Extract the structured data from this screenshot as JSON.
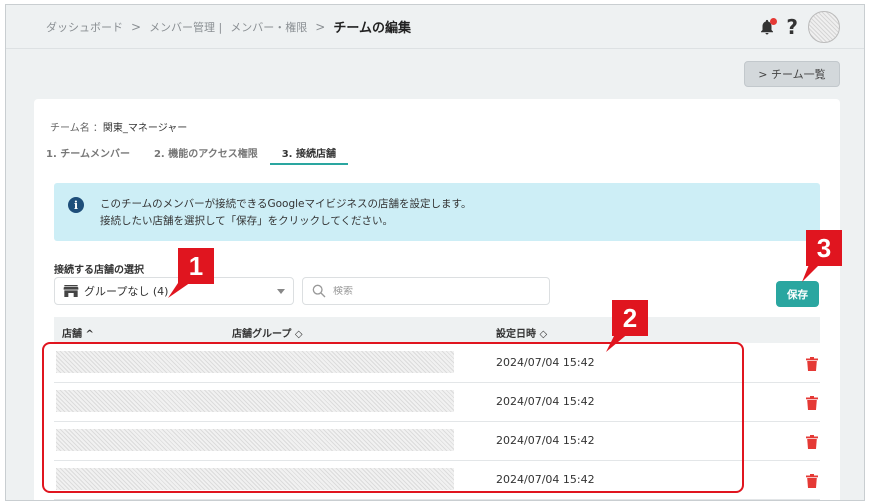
{
  "breadcrumb": {
    "items": [
      "ダッシュボード",
      "メンバー管理 |",
      "メンバー・権限"
    ],
    "current": "チームの編集",
    "separator": ">"
  },
  "header": {
    "bell_icon": "bell-icon",
    "help_label": "?",
    "avatar": "avatar"
  },
  "team_list_button": {
    "label": "> チーム一覧"
  },
  "team": {
    "label": "チーム名 ：",
    "name": "関東_マネージャー"
  },
  "tabs": [
    {
      "label": "1. チームメンバー",
      "active": false
    },
    {
      "label": "2. 機能のアクセス権限",
      "active": false
    },
    {
      "label": "3. 接続店舗",
      "active": true
    }
  ],
  "info": {
    "line1": "このチームのメンバーが接続できるGoogleマイビジネスの店舗を設定します。",
    "line2": "接続したい店舗を選択して「保存」をクリックしてください。"
  },
  "store_select": {
    "label": "接続する店舗の選択",
    "selected": "グループなし (4)"
  },
  "search": {
    "placeholder": "検索"
  },
  "save_button": {
    "label": "保存"
  },
  "table": {
    "columns": [
      "店舗 ^",
      "店舗グループ ◇",
      "設定日時 ◇"
    ],
    "rows": [
      {
        "date": "2024/07/04 15:42"
      },
      {
        "date": "2024/07/04 15:42"
      },
      {
        "date": "2024/07/04 15:42"
      },
      {
        "date": "2024/07/04 15:42"
      }
    ]
  },
  "annotations": [
    "1",
    "2",
    "3"
  ],
  "colors": {
    "accent": "#2aa6a0",
    "marker": "#e0151f",
    "delete": "#e53935",
    "info_bg": "#cdeef6"
  }
}
